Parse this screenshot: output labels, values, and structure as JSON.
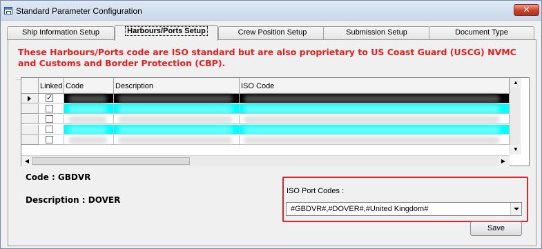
{
  "window": {
    "title": "Standard Parameter Configuration",
    "close_symbol": "✕"
  },
  "tabs": [
    {
      "label": "Ship Information Setup"
    },
    {
      "label": "Harbours/Ports Setup"
    },
    {
      "label": "Crew Position Setup"
    },
    {
      "label": "Submission Setup"
    },
    {
      "label": "Document Type"
    }
  ],
  "active_tab": "Harbours/Ports Setup",
  "notice": "These Harbours/Ports code are ISO standard but are also proprietary to US Coast Guard (USCG) NVMC and Customs and Border Protection (CBP).",
  "grid": {
    "columns": [
      "Linked",
      "Code",
      "Description",
      "ISO Code"
    ],
    "rows": [
      {
        "linked": true,
        "selected": true
      },
      {
        "linked": false,
        "selected": false
      },
      {
        "linked": false,
        "selected": false
      },
      {
        "linked": false,
        "selected": false
      },
      {
        "linked": false,
        "selected": false
      }
    ],
    "colors": {
      "selected_row": "#000000",
      "alt_row": "#00ffff",
      "plain_row": "#ffffff"
    }
  },
  "details": {
    "code_label": "Code : GBDVR",
    "description_label": "Description : DOVER"
  },
  "iso": {
    "label": "ISO Port Codes :",
    "selected_value": "#GBDVR#,#DOVER#,#United Kingdom#"
  },
  "buttons": {
    "save": "Save"
  }
}
